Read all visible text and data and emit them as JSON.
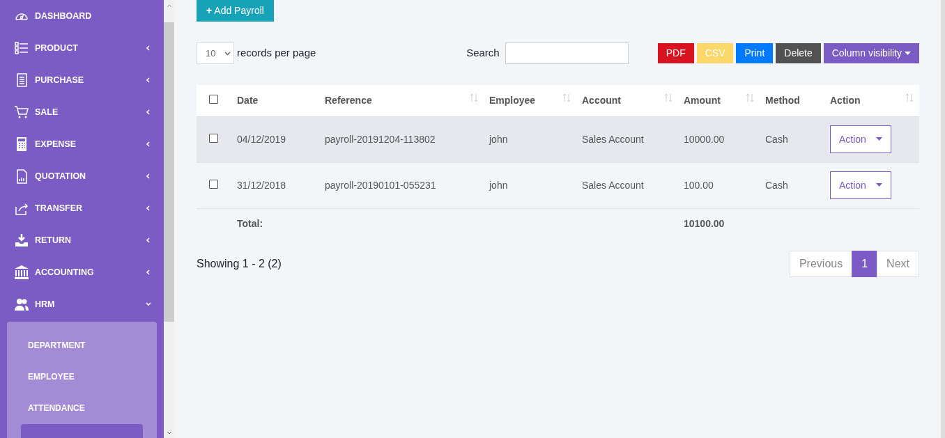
{
  "sidebar": {
    "items": [
      {
        "label": "DASHBOARD"
      },
      {
        "label": "PRODUCT",
        "expanded": false
      },
      {
        "label": "PURCHASE",
        "expanded": false
      },
      {
        "label": "SALE",
        "expanded": false
      },
      {
        "label": "EXPENSE",
        "expanded": false
      },
      {
        "label": "QUOTATION",
        "expanded": false
      },
      {
        "label": "TRANSFER",
        "expanded": false
      },
      {
        "label": "RETURN",
        "expanded": false
      },
      {
        "label": "ACCOUNTING",
        "expanded": false
      },
      {
        "label": "HRM",
        "expanded": true,
        "children": [
          {
            "label": "DEPARTMENT",
            "selected": false
          },
          {
            "label": "EMPLOYEE",
            "selected": false
          },
          {
            "label": "ATTENDANCE",
            "selected": false
          }
        ]
      }
    ]
  },
  "add_button": "Add Payroll",
  "add_icon": "+",
  "page_length": {
    "value": "10",
    "label": "records per page"
  },
  "search": {
    "label": "Search"
  },
  "export_buttons": [
    {
      "label": "PDF",
      "kind": "pdf"
    },
    {
      "label": "CSV",
      "kind": "csv"
    },
    {
      "label": "Print",
      "kind": "print"
    },
    {
      "label": "Delete",
      "kind": "delete"
    },
    {
      "label": "Column visibility",
      "kind": "dropdown"
    }
  ],
  "table": {
    "header_checked": false,
    "columns": [
      {
        "label": "Date",
        "sortable": false
      },
      {
        "label": "Reference",
        "sortable": true
      },
      {
        "label": "Employee",
        "sortable": true
      },
      {
        "label": "Account",
        "sortable": true
      },
      {
        "label": "Amount",
        "sortable": true
      },
      {
        "label": "Method",
        "sortable": false
      },
      {
        "label": "Action",
        "sortable": true
      }
    ],
    "rows": [
      {
        "checked": false,
        "highlighted": true,
        "cells": [
          "04/12/2019",
          "payroll-20191204-113802",
          "john",
          "Sales Account",
          "10000.00",
          "Cash"
        ],
        "action": "Action"
      },
      {
        "checked": false,
        "highlighted": false,
        "cells": [
          "31/12/2018",
          "payroll-20190101-055231",
          "john",
          "Sales Account",
          "100.00",
          "Cash"
        ],
        "action": "Action"
      }
    ],
    "footer": {
      "label": "Total:",
      "amount": "10100.00"
    }
  },
  "info": "Showing 1 - 2 (2)",
  "pagination": [
    {
      "label": "Previous",
      "selected": false
    },
    {
      "label": "1",
      "selected": true
    },
    {
      "label": "Next",
      "selected": false
    }
  ]
}
